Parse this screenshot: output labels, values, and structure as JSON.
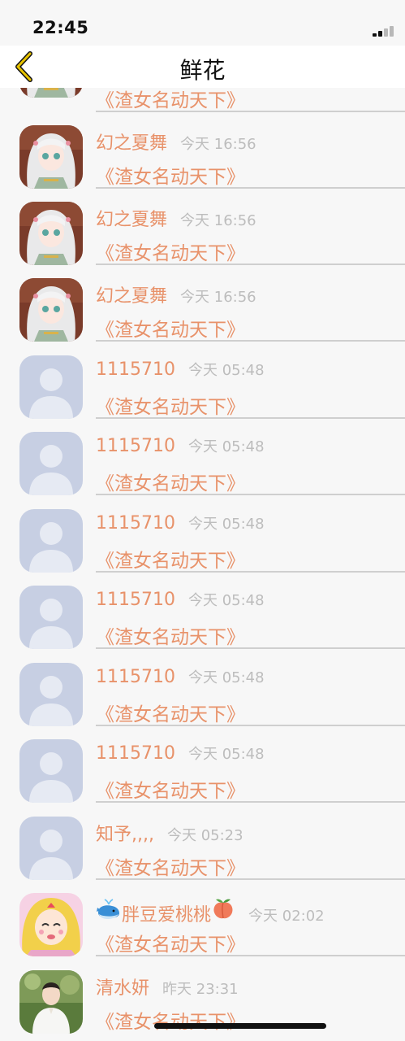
{
  "status_bar": {
    "time": "22:45"
  },
  "nav": {
    "title": "鲜花",
    "back_icon": "chevron-left-icon"
  },
  "colors": {
    "accent": "#e8926a",
    "muted": "#bdbdbd",
    "back": "#e6c200"
  },
  "messages": [
    {
      "name": "",
      "time": "",
      "msg": "《渣女名动天下》",
      "avatar": "anime-girl"
    },
    {
      "name": "幻之夏舞",
      "time": "今天 16:56",
      "msg": "《渣女名动天下》",
      "avatar": "anime-girl"
    },
    {
      "name": "幻之夏舞",
      "time": "今天 16:56",
      "msg": "《渣女名动天下》",
      "avatar": "anime-girl"
    },
    {
      "name": "幻之夏舞",
      "time": "今天 16:56",
      "msg": "《渣女名动天下》",
      "avatar": "anime-girl"
    },
    {
      "name": "1115710",
      "time": "今天 05:48",
      "msg": "《渣女名动天下》",
      "avatar": "default"
    },
    {
      "name": "1115710",
      "time": "今天 05:48",
      "msg": "《渣女名动天下》",
      "avatar": "default"
    },
    {
      "name": "1115710",
      "time": "今天 05:48",
      "msg": "《渣女名动天下》",
      "avatar": "default"
    },
    {
      "name": "1115710",
      "time": "今天 05:48",
      "msg": "《渣女名动天下》",
      "avatar": "default"
    },
    {
      "name": "1115710",
      "time": "今天 05:48",
      "msg": "《渣女名动天下》",
      "avatar": "default"
    },
    {
      "name": "1115710",
      "time": "今天 05:48",
      "msg": "《渣女名动天下》",
      "avatar": "default"
    },
    {
      "name": "知予,,,,",
      "time": "今天 05:23",
      "msg": "《渣女名动天下》",
      "avatar": "default"
    },
    {
      "name": "胖豆爱桃桃",
      "time": "今天 02:02",
      "msg": "《渣女名动天下》",
      "avatar": "sailor-moon",
      "prefix_icon": "whale-icon",
      "suffix_icon": "peach-icon"
    },
    {
      "name": "清水妍",
      "time": "昨天 23:31",
      "msg": "《渣女名动天下》",
      "avatar": "photo-boy"
    }
  ]
}
